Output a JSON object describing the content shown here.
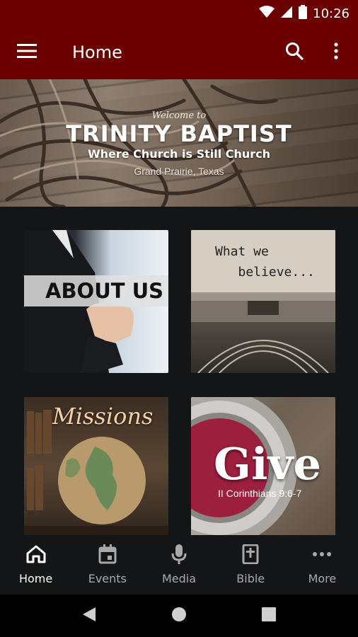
{
  "status_bar": {
    "time": "10:26",
    "icons": [
      "wifi-icon",
      "signal-icon",
      "battery-icon"
    ]
  },
  "app_bar": {
    "title": "Home",
    "icons": [
      "menu-icon",
      "search-icon",
      "more-vert-icon"
    ],
    "color": "#6b0000"
  },
  "banner": {
    "welcome": "Welcome to",
    "title": "TRINITY BAPTIST",
    "subtitle": "Where Church is Still Church",
    "location": "Grand Prairie, Texas"
  },
  "tiles": {
    "about": {
      "label": "ABOUT US"
    },
    "believe": {
      "label": "What we\n   believe..."
    },
    "missions": {
      "label": "Missions"
    },
    "give": {
      "label": "Give",
      "verse": "II Corinthians 9:6-7"
    }
  },
  "bottom_nav": {
    "items": [
      {
        "label": "Home",
        "icon": "home-icon",
        "active": true
      },
      {
        "label": "Events",
        "icon": "calendar-icon",
        "active": false
      },
      {
        "label": "Media",
        "icon": "microphone-icon",
        "active": false
      },
      {
        "label": "Bible",
        "icon": "bible-icon",
        "active": false
      },
      {
        "label": "More",
        "icon": "more-horiz-icon",
        "active": false
      }
    ]
  },
  "system_nav": {
    "icons": [
      "back-icon",
      "home-circle-icon",
      "recents-icon"
    ]
  },
  "colors": {
    "primary": "#6b0000",
    "background": "#141517",
    "nav_active": "#ffffff",
    "nav_inactive": "#a9a9a9"
  }
}
